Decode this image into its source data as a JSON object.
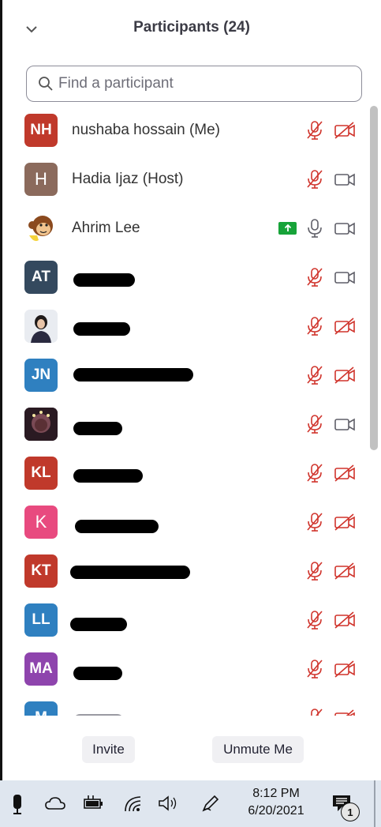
{
  "header": {
    "title": "Participants (24)"
  },
  "search": {
    "placeholder": "Find a participant"
  },
  "participants": [
    {
      "name": "nushaba hossain (Me)",
      "initials": "NH",
      "avatar_color": "#c0392b",
      "mic": "muted",
      "video": "off",
      "redacted": false
    },
    {
      "name": "Hadia Ijaz (Host)",
      "initials": "H",
      "avatar_color": "#8b6a5c",
      "mic": "muted",
      "video": "on",
      "redacted": false
    },
    {
      "name": "Ahrim Lee",
      "initials": "",
      "avatar_color": "#ffffff",
      "mic": "on",
      "video": "on",
      "sharing": true,
      "redacted": false
    },
    {
      "name": "",
      "initials": "AT",
      "avatar_color": "#34495e",
      "mic": "muted",
      "video": "on",
      "redacted": true
    },
    {
      "name": "",
      "initials": "",
      "avatar_color": "#eef0f3",
      "mic": "muted",
      "video": "off",
      "redacted": true
    },
    {
      "name": "",
      "initials": "JN",
      "avatar_color": "#2f80c0",
      "mic": "muted",
      "video": "off",
      "redacted": true
    },
    {
      "name": "",
      "initials": "",
      "avatar_color": "#2a1a22",
      "mic": "muted",
      "video": "on",
      "redacted": true
    },
    {
      "name": "",
      "initials": "KL",
      "avatar_color": "#c0392b",
      "mic": "muted",
      "video": "off",
      "redacted": true
    },
    {
      "name": "",
      "initials": "K",
      "avatar_color": "#e84a7f",
      "mic": "muted",
      "video": "off",
      "redacted": true
    },
    {
      "name": "",
      "initials": "KT",
      "avatar_color": "#c0392b",
      "mic": "muted",
      "video": "off",
      "redacted": true
    },
    {
      "name": "",
      "initials": "LL",
      "avatar_color": "#2f80c0",
      "mic": "muted",
      "video": "off",
      "redacted": true
    },
    {
      "name": "",
      "initials": "MA",
      "avatar_color": "#8e44ad",
      "mic": "muted",
      "video": "off",
      "redacted": true
    },
    {
      "name": "",
      "initials": "M",
      "avatar_color": "#2f80c0",
      "mic": "muted",
      "video": "off",
      "redacted": true
    }
  ],
  "footer": {
    "invite_label": "Invite",
    "unmute_label": "Unmute Me"
  },
  "taskbar": {
    "time": "8:12 PM",
    "date": "6/20/2021",
    "notification_count": "1"
  },
  "colors": {
    "muted_red": "#d0342c",
    "icon_gray": "#5f5f68",
    "share_green": "#17a339"
  }
}
